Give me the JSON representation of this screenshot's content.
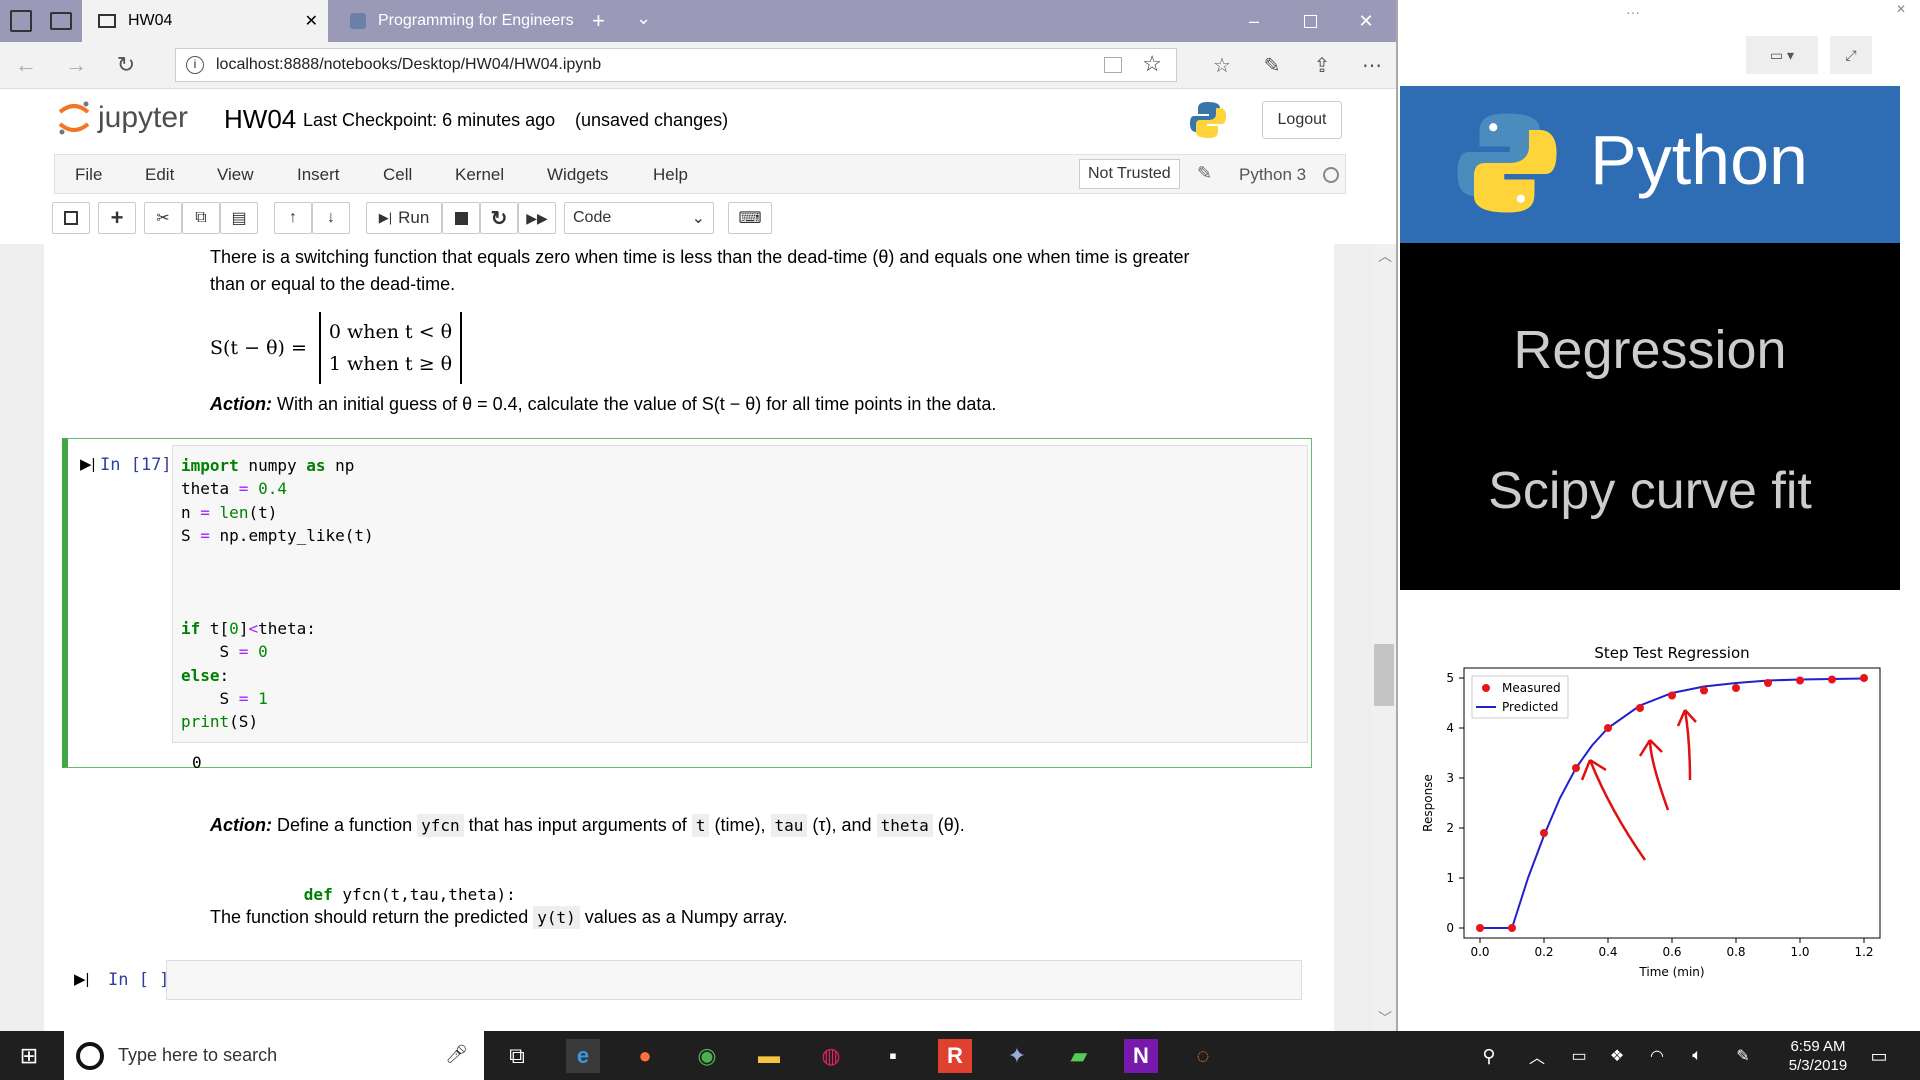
{
  "browser": {
    "tabs": [
      {
        "label": "HW04",
        "close": "✕"
      },
      {
        "label": "Programming for Engineers"
      }
    ],
    "url": "localhost:8888/notebooks/Desktop/HW04/HW04.ipynb"
  },
  "jupyter": {
    "logo_text": "jupyter",
    "notebook_name": "HW04",
    "checkpoint": "Last Checkpoint: 6 minutes ago",
    "unsaved": "(unsaved changes)",
    "logout": "Logout",
    "menus": [
      "File",
      "Edit",
      "View",
      "Insert",
      "Cell",
      "Kernel",
      "Widgets",
      "Help"
    ],
    "not_trusted": "Not Trusted",
    "kernel": "Python 3",
    "run_label": "Run",
    "cell_type": "Code"
  },
  "notebook": {
    "md1_line1": "There is a switching function that equals zero when time is less than the dead-time (θ) and equals one when time is greater",
    "md1_line2": "than or equal to the dead-time.",
    "eq_lhs": "S(t − θ) =",
    "eq_row1": "0 when t < θ",
    "eq_row2": "1 when t ≥ θ",
    "action1_label": "Action:",
    "action1_text": "With an initial guess of θ = 0.4, calculate the value of S(t − θ) for all time points in the data.",
    "cell1_prompt": "In [17]:",
    "cell1_output": "0",
    "action2_label": "Action:",
    "action2_a": "Define a function",
    "action2_fn": "yfcn",
    "action2_b": "that has input arguments of",
    "action2_t": "t",
    "action2_c": "(time),",
    "action2_tau": "tau",
    "action2_d": "(τ), and",
    "action2_theta": "theta",
    "action2_e": "(θ).",
    "def_kw": "def",
    "def_rest": "yfcn(t,tau,theta):",
    "return_a": "The function should return the predicted",
    "return_code": "y(t)",
    "return_b": "values as a Numpy array.",
    "cell2_prompt": "In [ ]:"
  },
  "slide": {
    "python_title": "Python",
    "topic1": "Regression",
    "topic2": "Scipy curve fit"
  },
  "taskbar": {
    "search_placeholder": "Type here to search",
    "time": "6:59 AM",
    "date": "5/3/2019"
  },
  "chart_data": {
    "type": "scatter",
    "title": "Step Test Regression",
    "xlabel": "Time (min)",
    "ylabel": "Response",
    "xlim": [
      -0.05,
      1.25
    ],
    "ylim": [
      -0.2,
      5.2
    ],
    "x_ticks": [
      "0.0",
      "0.2",
      "0.4",
      "0.6",
      "0.8",
      "1.0",
      "1.2"
    ],
    "y_ticks": [
      "0",
      "1",
      "2",
      "3",
      "4",
      "5"
    ],
    "legend": "top-left",
    "series": [
      {
        "name": "Measured",
        "color": "#e8141b",
        "x": [
          0.0,
          0.1,
          0.2,
          0.3,
          0.4,
          0.5,
          0.6,
          0.7,
          0.8,
          0.9,
          1.0,
          1.1,
          1.2
        ],
        "y": [
          0.0,
          0.0,
          1.9,
          3.2,
          4.0,
          4.4,
          4.65,
          4.75,
          4.8,
          4.9,
          4.95,
          4.97,
          5.0
        ]
      },
      {
        "name": "Predicted",
        "color": "#2020cc",
        "x": [
          0.0,
          0.1,
          0.15,
          0.2,
          0.25,
          0.3,
          0.35,
          0.4,
          0.5,
          0.6,
          0.7,
          0.8,
          0.9,
          1.0,
          1.1,
          1.2
        ],
        "y": [
          0.0,
          0.0,
          1.0,
          1.85,
          2.6,
          3.2,
          3.65,
          4.0,
          4.45,
          4.7,
          4.83,
          4.9,
          4.95,
          4.97,
          4.98,
          4.99
        ]
      }
    ]
  }
}
